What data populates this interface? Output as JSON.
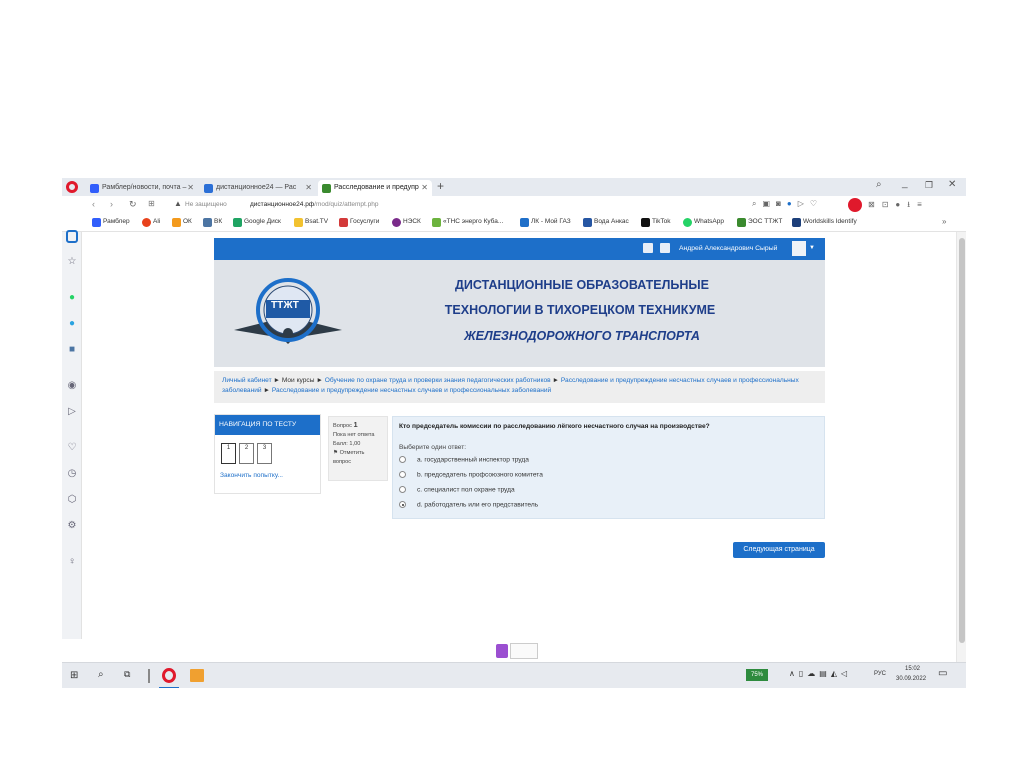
{
  "browser": {
    "tabs": [
      {
        "label": "Рамблер/новости, почта –",
        "color": "#315efb"
      },
      {
        "label": "дистанционное24 — Рас",
        "color": "#2b6fd6"
      },
      {
        "label": "Расследование и предупр",
        "color": "#3a8a2e"
      }
    ],
    "address": {
      "warning": "Не защищено",
      "host": "дистанционное24.рф",
      "path": "/mod/quiz/attempt.php"
    },
    "bookmarks": [
      {
        "label": "Рамблер",
        "color": "#315efb"
      },
      {
        "label": "Ali",
        "color": "#e8421c"
      },
      {
        "label": "ОК",
        "color": "#f39a1d"
      },
      {
        "label": "ВК",
        "color": "#4c75a3"
      },
      {
        "label": "Google Диск",
        "color": "#1fa463"
      },
      {
        "label": "Bsat.TV",
        "color": "#f2c230"
      },
      {
        "label": "Госуслуги",
        "color": "#d33a3a"
      },
      {
        "label": "НЭСК",
        "color": "#7a2a8a"
      },
      {
        "label": "«ТНС энерго Куба...",
        "color": "#6cb33e"
      },
      {
        "label": "ЛК - Мой ГАЗ",
        "color": "#1f6fc9"
      },
      {
        "label": "Вода Анкас",
        "color": "#2656a3"
      },
      {
        "label": "TikTok",
        "color": "#111111"
      },
      {
        "label": "WhatsApp",
        "color": "#25d366"
      },
      {
        "label": "ЭОС ТТЖТ",
        "color": "#3a8a2e"
      },
      {
        "label": "Worldskills Identify",
        "color": "#1d3f7a"
      }
    ],
    "more_label": "»"
  },
  "moodle": {
    "user_name": "Андрей Александрович Сырый",
    "banner": {
      "logo_text": "ТТЖТ",
      "line1": "ДИСТАНЦИОННЫЕ ОБРАЗОВАТЕЛЬНЫЕ",
      "line2": "ТЕХНОЛОГИИ В ТИХОРЕЦКОМ ТЕХНИКУМЕ",
      "line3": "ЖЕЛЕЗНОДОРОЖНОГО ТРАНСПОРТА"
    },
    "breadcrumb": {
      "home": "Личный кабинет",
      "sep": "►",
      "my_courses": "Мои курсы",
      "course": "Обучение по охране труда и проверки знания педагогических работников",
      "section": "Расследование и предупреждение несчастных случаев и профессиональных заболеваний",
      "quiz": "Расследование и предупреждение несчастных случаев и профессиональных заболеваний"
    },
    "nav": {
      "title": "НАВИГАЦИЯ ПО ТЕСТУ",
      "questions": [
        "1",
        "2",
        "3"
      ],
      "finish_link": "Закончить попытку..."
    },
    "info": {
      "question_label": "Вопрос",
      "question_number": "1",
      "status": "Пока нет ответа",
      "score": "Балл: 1,00",
      "flag": "Отметить вопрос"
    },
    "question": {
      "text": "Кто председатель комиссии по расследованию лёгкого несчастного случая на производстве?",
      "prompt": "Выберите один ответ:",
      "options": [
        {
          "label": "a. государственный инспектор труда",
          "selected": false
        },
        {
          "label": "b. председатель профсоюзного комитета",
          "selected": false
        },
        {
          "label": "c. специалист пол охране труда",
          "selected": false
        },
        {
          "label": "d. работодатель или его представитель",
          "selected": true
        }
      ]
    },
    "next_button": "Следующая страница"
  },
  "taskbar": {
    "battery": "75%",
    "lang": "РУС",
    "time": "15:02",
    "date": "30.09.2022"
  }
}
